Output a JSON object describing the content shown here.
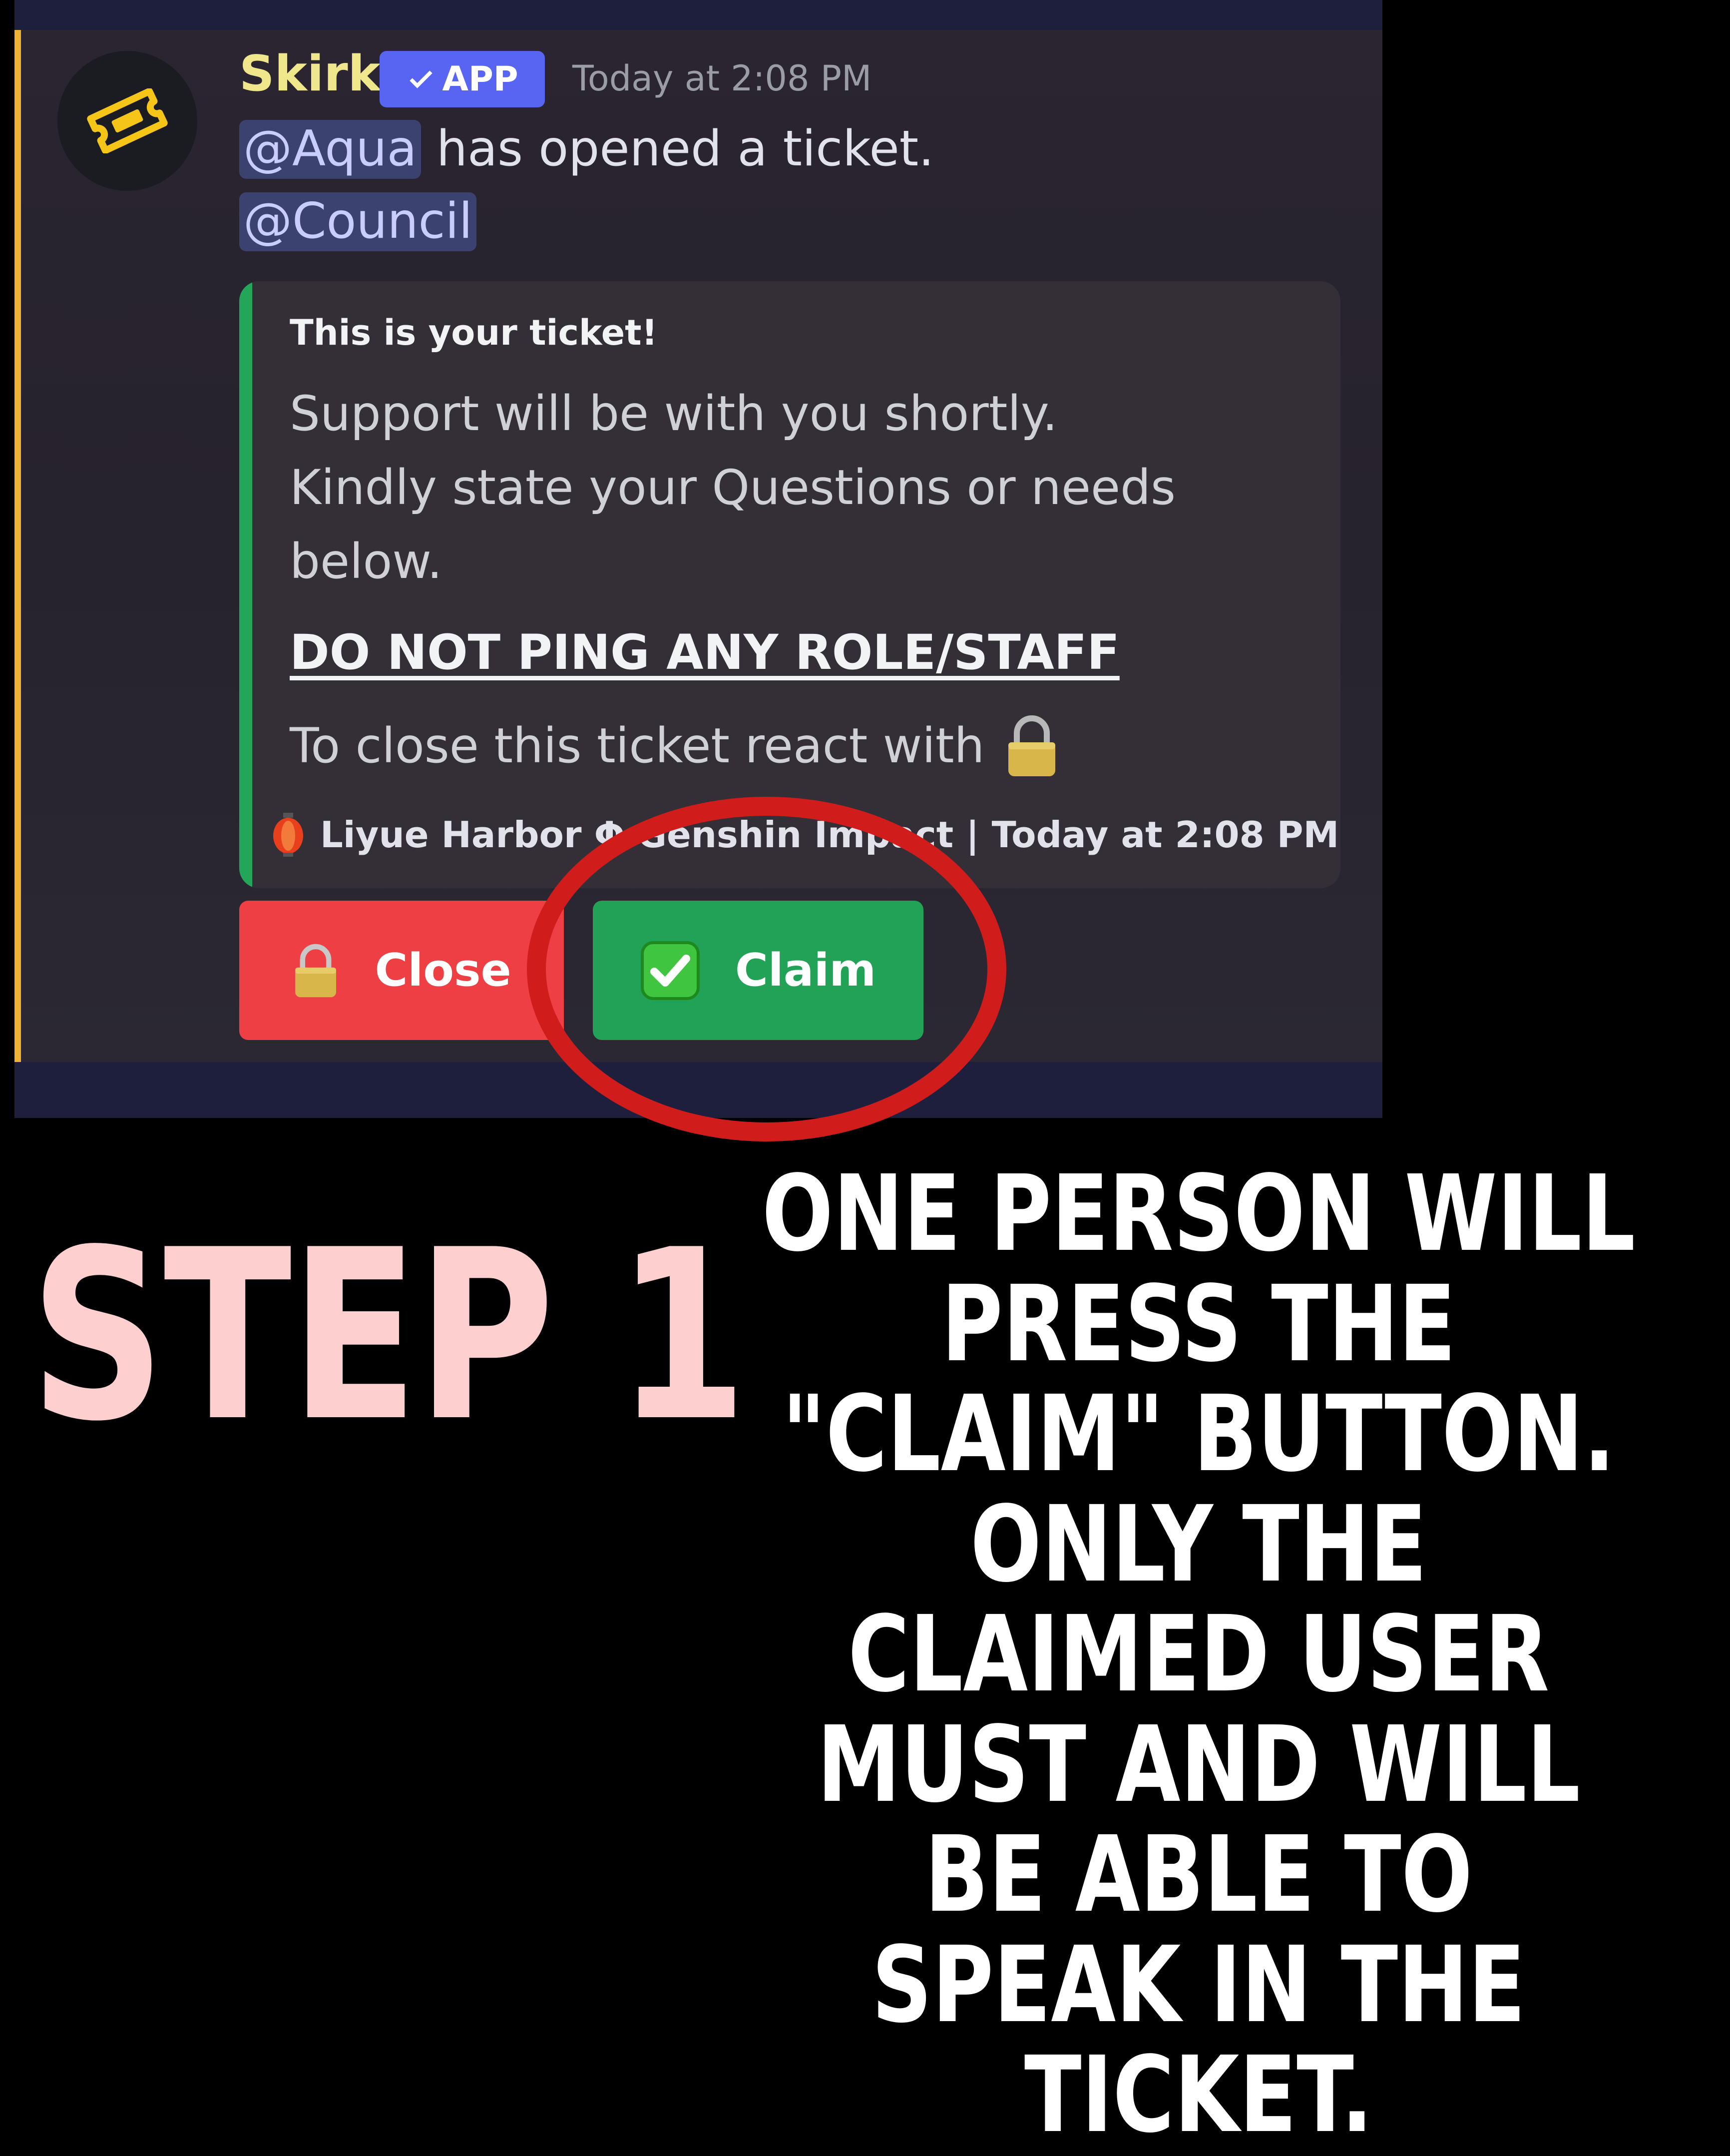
{
  "message": {
    "author": "Skirk",
    "app_badge": "APP",
    "timestamp": "Today at 2:08 PM",
    "mention_user": "@Aqua",
    "opened_text": " has opened a ticket.",
    "mention_role": "@Council"
  },
  "embed": {
    "title": "This is your ticket!",
    "body_lines": [
      "Support will be with you shortly.",
      "Kindly state your Questions or needs",
      "below."
    ],
    "warning": "DO NOT PING ANY ROLE/STAFF",
    "close_hint": "To close this ticket react with",
    "footer": "Liyue Harbor Φ Genshin Impact | Today at 2:08 PM"
  },
  "buttons": {
    "close_label": "Close",
    "claim_label": "Claim"
  },
  "caption": {
    "step": "STEP 1",
    "description": "ONE PERSON WILL PRESS THE \"CLAIM\" BUTTON. ONLY THE CLAIMED USER MUST AND WILL BE ABLE TO SPEAK IN THE TICKET."
  },
  "colors": {
    "accent_bar": "#f0b232",
    "app_badge": "#5865f2",
    "embed_bar": "#23a55a",
    "close_button": "#ee4044",
    "claim_button": "#22a257",
    "highlight_circle": "#d11c1c",
    "step_title": "#fdd0cf"
  },
  "icons": {
    "avatar": "ticket-icon",
    "badge": "checkmark-icon",
    "lock": "lock-icon",
    "claim": "check-box-icon",
    "footer": "lantern-icon"
  }
}
